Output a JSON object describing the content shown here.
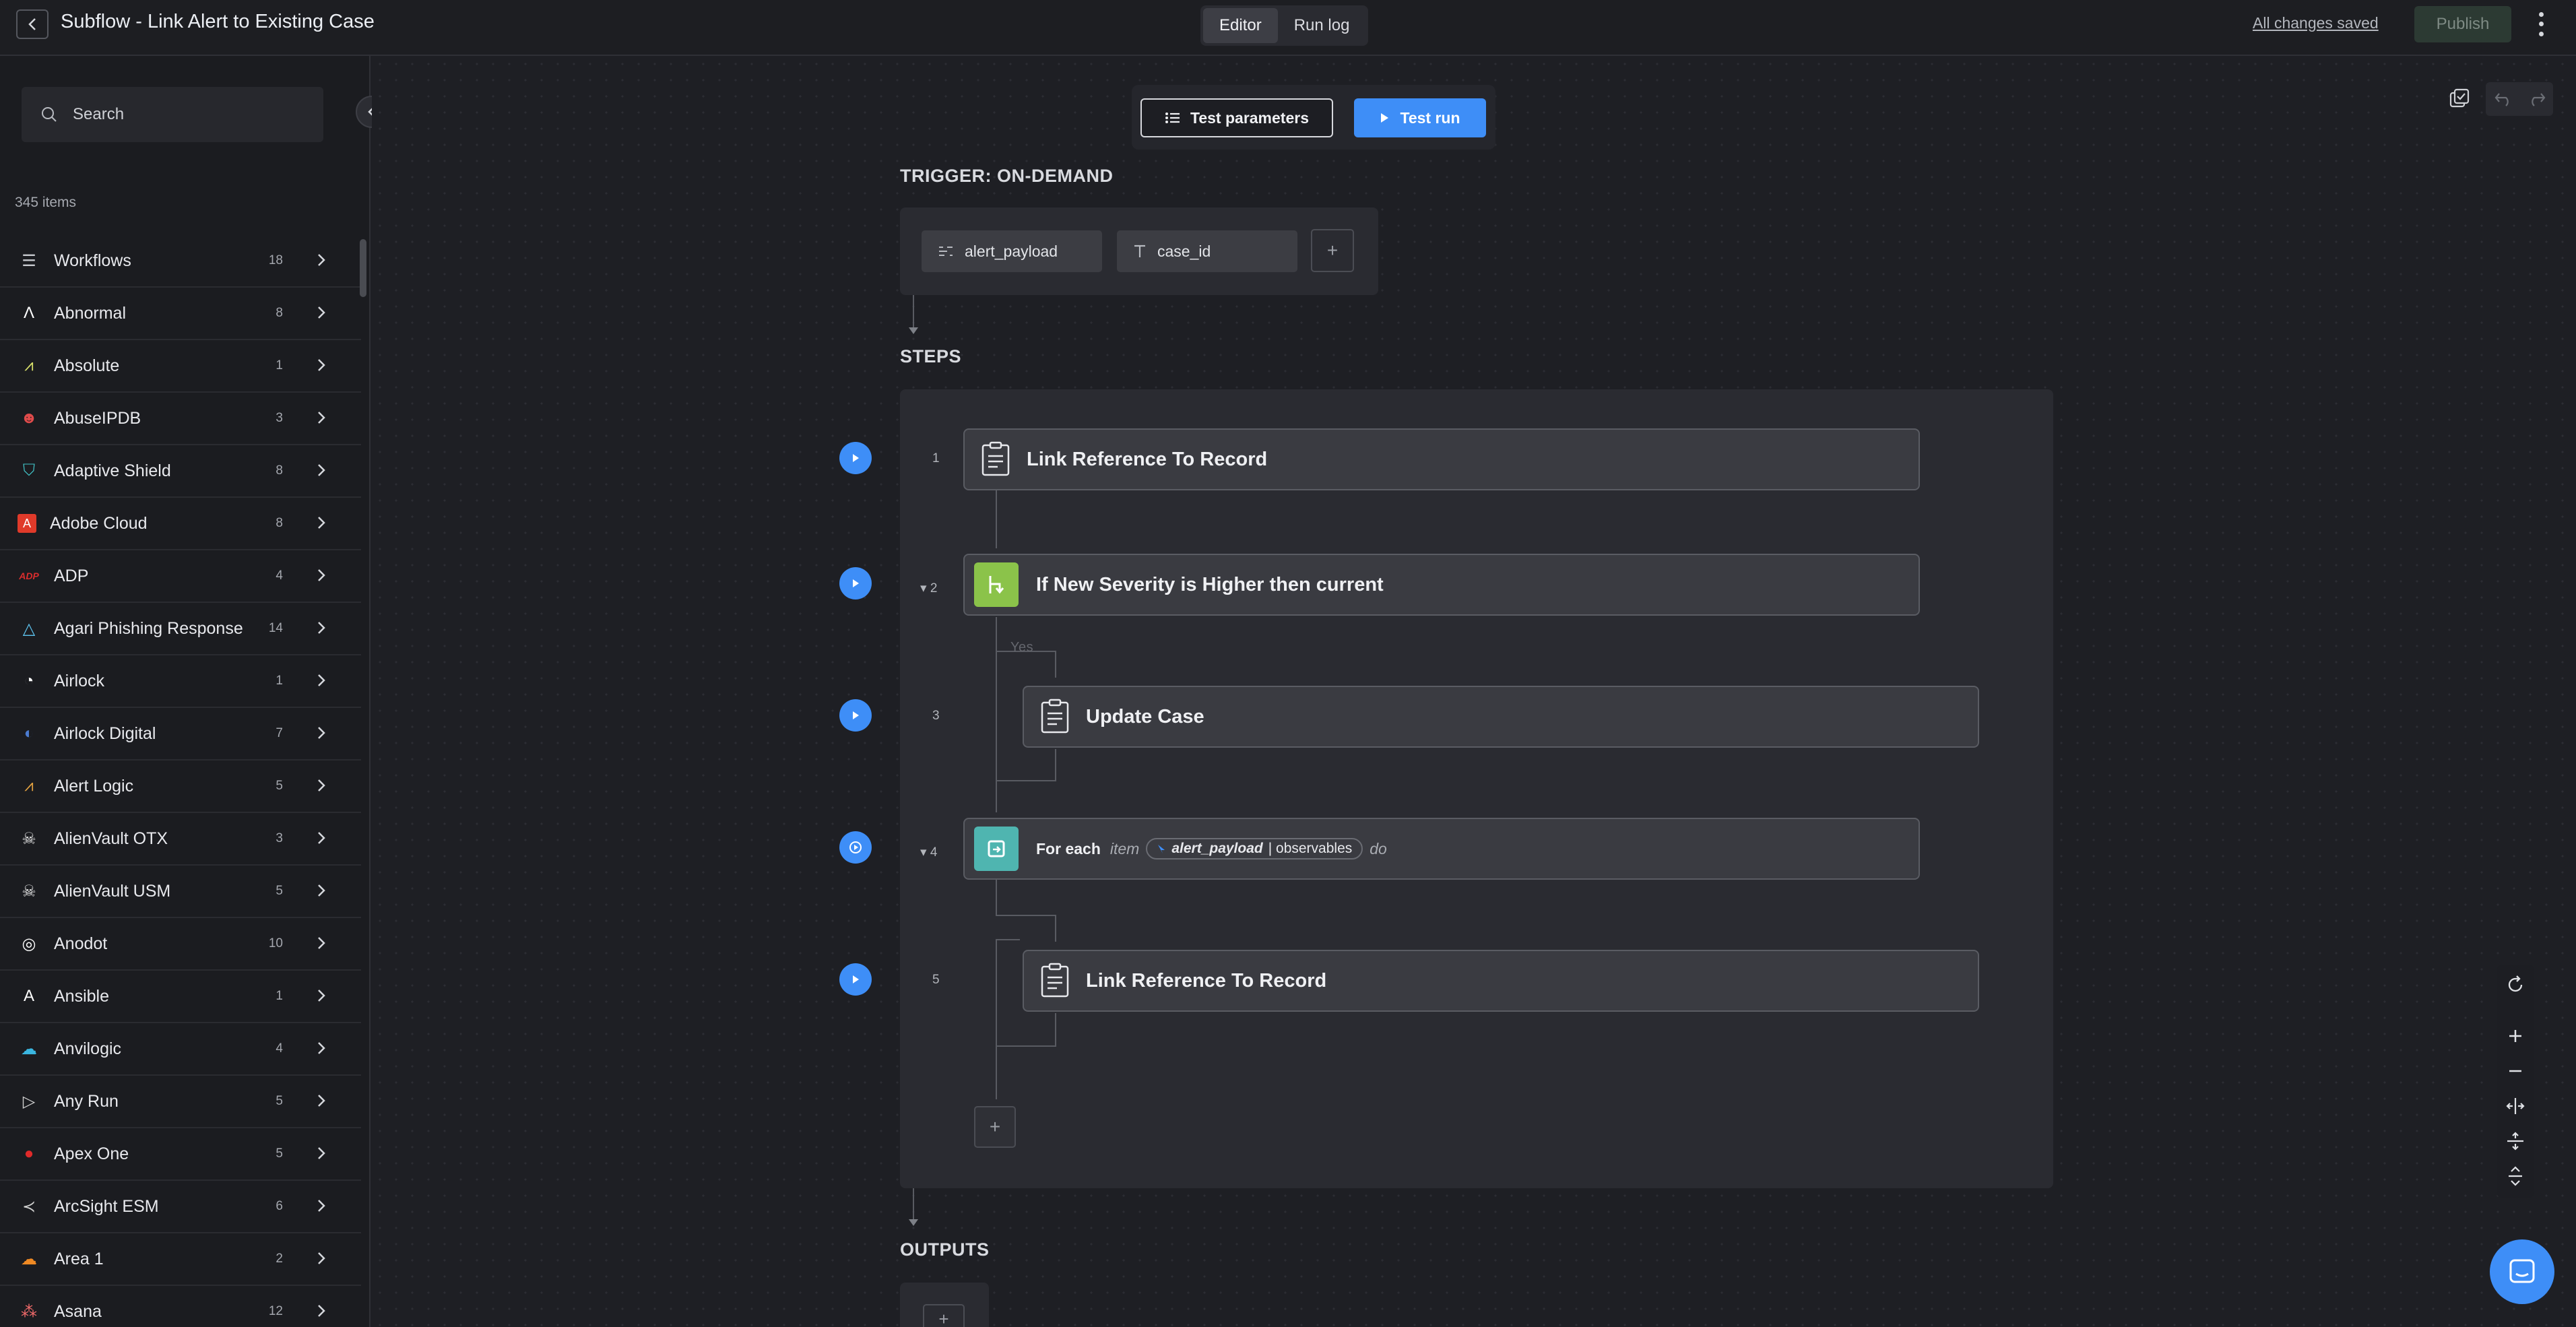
{
  "header": {
    "title": "Subflow - Link Alert to Existing Case",
    "tabs": [
      {
        "label": "Editor",
        "active": true
      },
      {
        "label": "Run log",
        "active": false
      }
    ],
    "saved_status": "All changes saved",
    "publish_label": "Publish"
  },
  "sidebar": {
    "search_placeholder": "Search",
    "items_count": "345 items",
    "items": [
      {
        "label": "Workflows",
        "count": "18",
        "icon": "workflows-icon"
      },
      {
        "label": "Abnormal",
        "count": "8",
        "icon": "abnormal-icon"
      },
      {
        "label": "Absolute",
        "count": "1",
        "icon": "absolute-icon"
      },
      {
        "label": "AbuseIPDB",
        "count": "3",
        "icon": "abuseipdb-icon"
      },
      {
        "label": "Adaptive Shield",
        "count": "8",
        "icon": "adaptive-shield-icon"
      },
      {
        "label": "Adobe Cloud",
        "count": "8",
        "icon": "adobe-icon"
      },
      {
        "label": "ADP",
        "count": "4",
        "icon": "adp-icon"
      },
      {
        "label": "Agari Phishing Response",
        "count": "14",
        "icon": "agari-icon"
      },
      {
        "label": "Airlock",
        "count": "1",
        "icon": "airlock-icon"
      },
      {
        "label": "Airlock Digital",
        "count": "7",
        "icon": "airlock-digital-icon"
      },
      {
        "label": "Alert Logic",
        "count": "5",
        "icon": "alert-logic-icon"
      },
      {
        "label": "AlienVault OTX",
        "count": "3",
        "icon": "alien-icon"
      },
      {
        "label": "AlienVault USM",
        "count": "5",
        "icon": "alien-icon"
      },
      {
        "label": "Anodot",
        "count": "10",
        "icon": "anodot-icon"
      },
      {
        "label": "Ansible",
        "count": "1",
        "icon": "ansible-icon"
      },
      {
        "label": "Anvilogic",
        "count": "4",
        "icon": "anvilogic-icon"
      },
      {
        "label": "Any Run",
        "count": "5",
        "icon": "any-run-icon"
      },
      {
        "label": "Apex One",
        "count": "5",
        "icon": "apex-one-icon"
      },
      {
        "label": "ArcSight ESM",
        "count": "6",
        "icon": "arcsight-icon"
      },
      {
        "label": "Area 1",
        "count": "2",
        "icon": "area1-icon"
      },
      {
        "label": "Asana",
        "count": "12",
        "icon": "asana-icon"
      }
    ]
  },
  "canvas": {
    "test_params_label": "Test parameters",
    "test_run_label": "Test run",
    "trigger_title": "TRIGGER: ON-DEMAND",
    "trigger_params": [
      "alert_payload",
      "case_id"
    ],
    "steps_title": "STEPS",
    "outputs_title": "OUTPUTS",
    "branch_label": "Yes",
    "steps": [
      {
        "num": "1",
        "label": "Link Reference To Record"
      },
      {
        "num": "2",
        "label": "If New Severity is Higher then current"
      },
      {
        "num": "3",
        "label": "Update Case"
      },
      {
        "num": "4",
        "label": "For each",
        "item": "item",
        "chip_bold": "alert_payload",
        "chip_rest": "| observables",
        "do": "do"
      },
      {
        "num": "5",
        "label": "Link Reference To Record"
      }
    ]
  },
  "colors": {
    "accent": "#3e8ef7",
    "condition": "#8bc34a",
    "loop": "#4fb5b0"
  }
}
